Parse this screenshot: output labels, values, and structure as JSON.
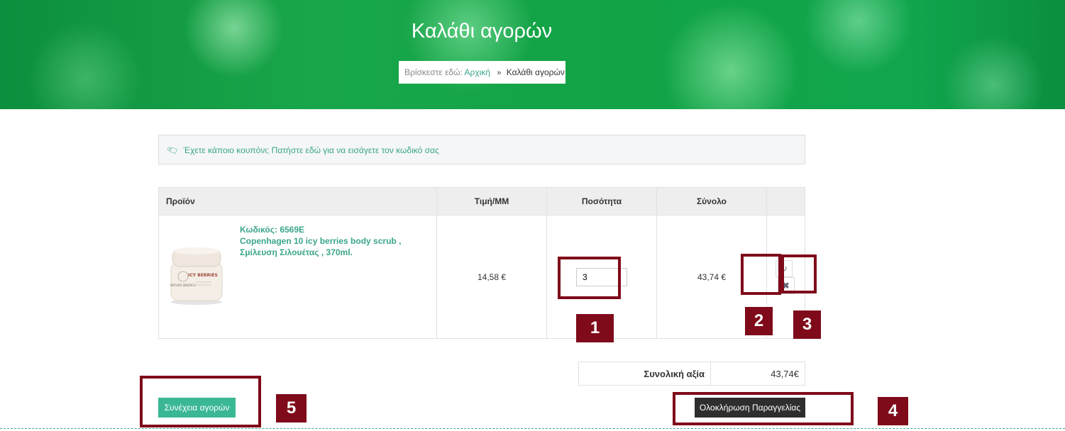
{
  "hero": {
    "title": "Καλάθι αγορών",
    "breadcrumb": {
      "label": "Βρίσκεστε εδώ:",
      "home": "Αρχική",
      "separator": "»",
      "current": "Καλάθι αγορών"
    }
  },
  "coupon": {
    "icon": "tag-icon",
    "text": "Έχετε κάποιο κουπόνι; Πατήστε εδώ για να εισάγετε τον κωδικό σας"
  },
  "cart": {
    "headers": {
      "product": "Προϊόν",
      "price": "Τιμή/ΜΜ",
      "quantity": "Ποσότητα",
      "total": "Σύνολο"
    },
    "item": {
      "code": "Κωδικός: 6569E",
      "name": "Copenhagen 10 icy berries body scrub , Σμίλευση Σιλουέτας , 370ml.",
      "image_brand": "NATURA SIBERICA",
      "image_text": "ICY BERRIES",
      "price": "14,58 €",
      "quantity": "3",
      "total": "43,74 €",
      "update_icon": "refresh-icon",
      "remove_icon": "close-icon"
    }
  },
  "totals": {
    "label": "Συνολική αξία",
    "value": "43,74€"
  },
  "buttons": {
    "continue": "Συνέχεια αγορών",
    "checkout": "Ολοκλήρωση Παραγγελίας"
  },
  "callouts": [
    "1",
    "2",
    "3",
    "4",
    "5"
  ],
  "colors": {
    "accent": "#3aa58a",
    "callout": "#7f0a1a",
    "checkout_bg": "#2e2e2e",
    "continue_bg": "#3ab795"
  }
}
